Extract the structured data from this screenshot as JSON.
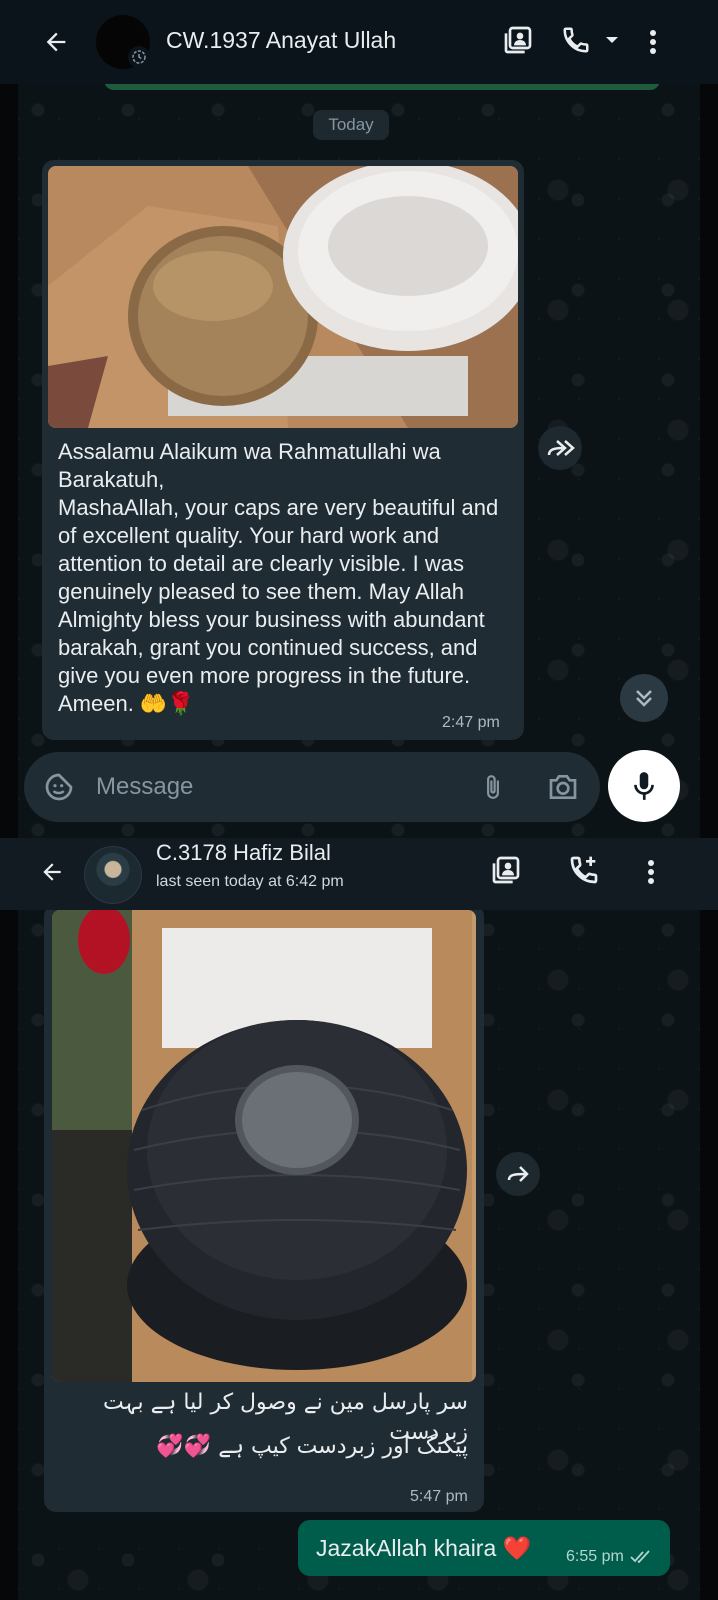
{
  "top_chat": {
    "contact_name": "CW.1937 Anayat Ullah",
    "date_chip": "Today",
    "incoming": {
      "text": "Assalamu Alaikum wa Rahmatullahi wa Barakatuh,\nMashaAllah, your caps are very beautiful and of excellent quality. Your hard work and attention to detail are clearly visible. I was genuinely pleased to see them. May Allah Almighty bless your business with abundant barakah, grant you continued success, and give you even more progress in the future. Ameen. 🤲🌹",
      "time": "2:47 pm"
    },
    "composer_placeholder": "Message"
  },
  "bottom_chat": {
    "contact_name": "C.3178 Hafiz Bilal",
    "last_seen": "last seen today at 6:42 pm",
    "incoming": {
      "line1": "سر پارسل مین نے وصول کر لیا ہے بہت زبردست",
      "line2": "پیکنگ اور زبردست کیپ ہے 💞💞",
      "time": "5:47 pm"
    },
    "outgoing": {
      "text": "JazakAllah khaira ❤️",
      "time": "6:55 pm"
    }
  },
  "icons": [
    "back-arrow-icon",
    "status-ring-icon",
    "contact-card-icon",
    "phone-icon",
    "dropdown-icon",
    "more-vert-icon",
    "forward-icon",
    "double-chevron-down-icon",
    "sticker-icon",
    "attach-icon",
    "camera-icon",
    "mic-icon",
    "add-call-icon",
    "double-tick-icon"
  ],
  "colors": {
    "header_bg": "#0b141a",
    "bubble_in": "#202c33",
    "bubble_out": "#005c4b",
    "accent_green": "#1f5c3d"
  }
}
